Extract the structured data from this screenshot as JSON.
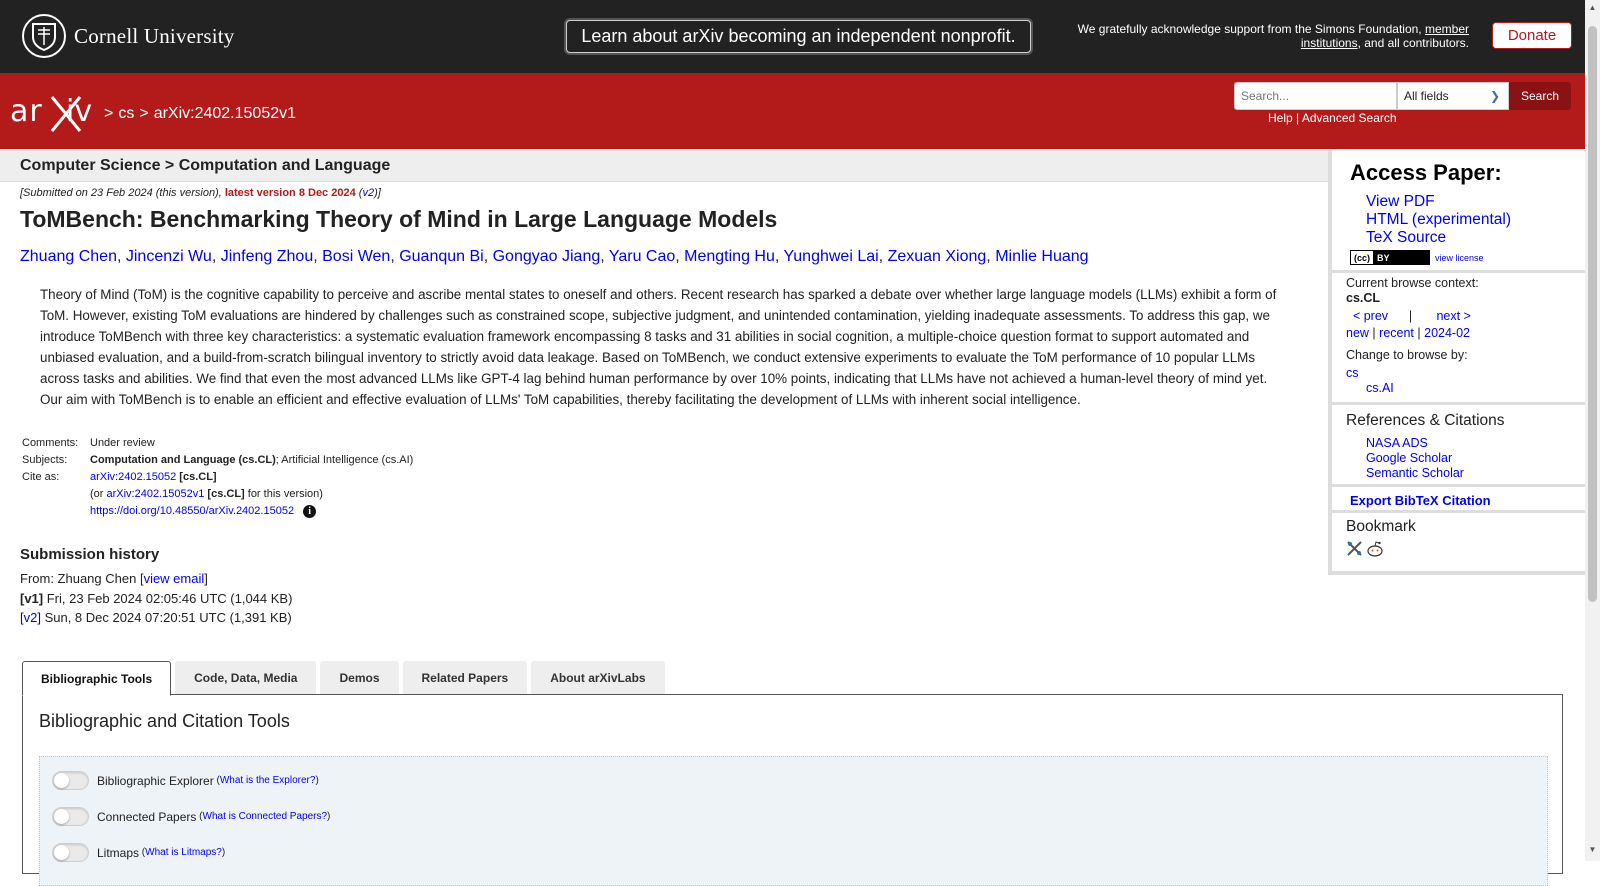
{
  "topbar": {
    "university": "Cornell University",
    "announcement": "Learn about arXiv becoming an independent nonprofit.",
    "support_text_1": "We gratefully acknowledge support from the Simons Foundation,",
    "support_link_1": "member",
    "support_link_2": "institutions",
    "support_text_2": ", and all contributors.",
    "donate": "Donate"
  },
  "header": {
    "breadcrumb": [
      ">",
      "cs",
      ">",
      "arXiv:2402.15052v1"
    ],
    "search_placeholder": "Search...",
    "search_field": "All fields",
    "search_button": "Search",
    "help": "Help",
    "separator": "|",
    "advanced": "Advanced Search"
  },
  "paper": {
    "category": "Computer Science > Computation and Language",
    "submitted_prefix": "[Submitted on 23 Feb 2024 (this version), ",
    "latest_version": "latest version 8 Dec 2024",
    "v2_open": " (",
    "v2": "v2",
    "v2_close": ")]",
    "title": "ToMBench: Benchmarking Theory of Mind in Large Language Models",
    "authors": [
      "Zhuang Chen",
      "Jincenzi Wu",
      "Jinfeng Zhou",
      "Bosi Wen",
      "Guanqun Bi",
      "Gongyao Jiang",
      "Yaru Cao",
      "Mengting Hu",
      "Yunghwei Lai",
      "Zexuan Xiong",
      "Minlie Huang"
    ],
    "author_sep": ", ",
    "abstract": "Theory of Mind (ToM) is the cognitive capability to perceive and ascribe mental states to oneself and others. Recent research has sparked a debate over whether large language models (LLMs) exhibit a form of ToM. However, existing ToM evaluations are hindered by challenges such as constrained scope, subjective judgment, and unintended contamination, yielding inadequate assessments. To address this gap, we introduce ToMBench with three key characteristics: a systematic evaluation framework encompassing 8 tasks and 31 abilities in social cognition, a multiple-choice question format to support automated and unbiased evaluation, and a build-from-scratch bilingual inventory to strictly avoid data leakage. Based on ToMBench, we conduct extensive experiments to evaluate the ToM performance of 10 popular LLMs across tasks and abilities. We find that even the most advanced LLMs like GPT-4 lag behind human performance by over 10% points, indicating that LLMs have not achieved a human-level theory of mind yet. Our aim with ToMBench is to enable an efficient and effective evaluation of LLMs' ToM capabilities, thereby facilitating the development of LLMs with inherent social intelligence.",
    "meta": {
      "comments_label": "Comments:",
      "comments": "Under review",
      "subjects_label": "Subjects:",
      "subjects_primary": "Computation and Language (cs.CL)",
      "subjects_rest": "; Artificial Intelligence (cs.AI)",
      "cite_label": "Cite as:",
      "cite_id": "arXiv:2402.15052",
      "cite_cat": "[cs.CL]",
      "cite_or": "(or ",
      "cite_version": "arXiv:2402.15052v1",
      "cite_version_cat": "[cs.CL]",
      "cite_for": " for this version)",
      "doi": "https://doi.org/10.48550/arXiv.2402.15052",
      "info_icon": "i"
    },
    "history": {
      "heading": "Submission history",
      "from": "From: Zhuang Chen [",
      "view_email": "view email",
      "from_close": "]",
      "v1_label": "[v1]",
      "v1": " Fri, 23 Feb 2024 02:05:46 UTC (1,044 KB)",
      "v2_label": "[v2]",
      "v2": " Sun, 8 Dec 2024 07:20:51 UTC (1,391 KB)"
    }
  },
  "tabs": [
    "Bibliographic Tools",
    "Code, Data, Media",
    "Demos",
    "Related Papers",
    "About arXivLabs"
  ],
  "tools": {
    "heading": "Bibliographic and Citation Tools",
    "rows": [
      {
        "label": "Bibliographic Explorer",
        "q": "What is the Explorer?"
      },
      {
        "label": "Connected Papers",
        "q": "What is Connected Papers?"
      },
      {
        "label": "Litmaps",
        "q": "What is Litmaps?"
      }
    ]
  },
  "sidebar": {
    "access_heading": "Access Paper:",
    "access_links": [
      "View PDF",
      "HTML (experimental)",
      "TeX Source"
    ],
    "cc_left": "(cc)",
    "cc_right": "BY",
    "view_license": "view license",
    "context_label": "Current browse context:",
    "context_value": "cs.CL",
    "prev": "< prev",
    "pipe": "|",
    "next": "next >",
    "new": "new",
    "recent": "recent",
    "month": "2024-02",
    "change_label": "Change to browse by:",
    "change_cs": "cs",
    "change_ai": "cs.AI",
    "refs_heading": "References & Citations",
    "refs": [
      "NASA ADS",
      "Google Scholar",
      "Semantic Scholar"
    ],
    "bibtex": "Export BibTeX Citation",
    "bookmark_heading": "Bookmark"
  }
}
